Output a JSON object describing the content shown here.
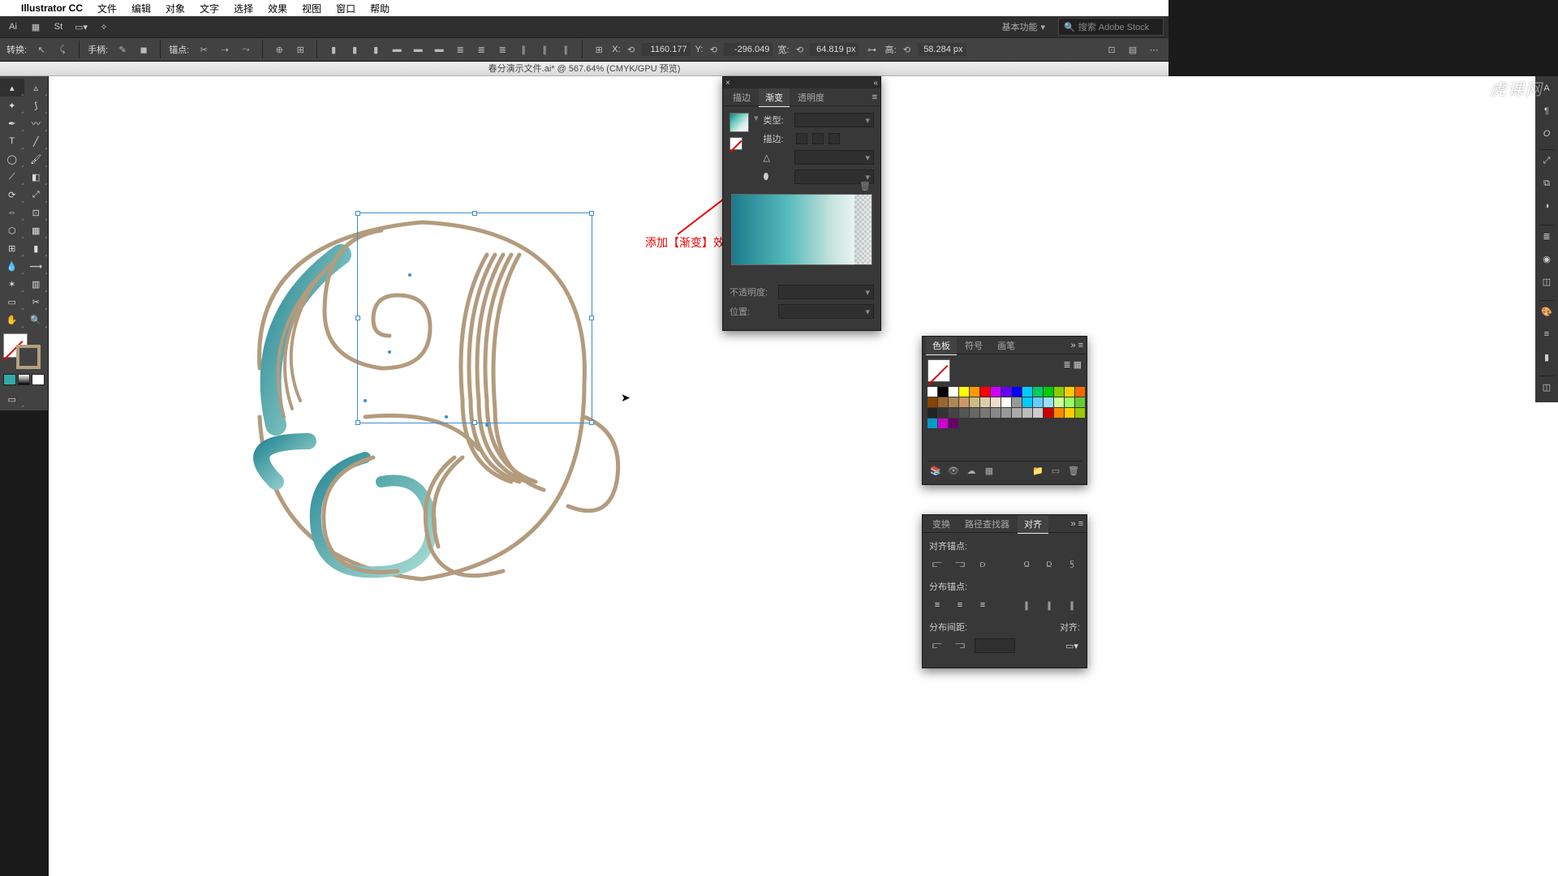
{
  "menubar": {
    "app": "Illustrator CC",
    "items": [
      "文件",
      "编辑",
      "对象",
      "文字",
      "选择",
      "效果",
      "视图",
      "窗口",
      "帮助"
    ]
  },
  "appbar": {
    "basic": "基本功能",
    "search_placeholder": "搜索 Adobe Stock"
  },
  "ctrl": {
    "transform": "转换:",
    "handle": "手柄:",
    "anchor": "锚点:",
    "x": "X:",
    "y": "Y:",
    "w": "宽:",
    "h": "高:",
    "xv": "1160.177",
    "yv": "-296.049",
    "wv": "64.819 px",
    "hv": "58.284 px"
  },
  "document": {
    "title": "春分演示文件.ai* @ 567.64% (CMYK/GPU 预览)"
  },
  "gradient": {
    "tabs": [
      "描边",
      "渐变",
      "透明度"
    ],
    "active_tab": "渐变",
    "type_label": "类型:",
    "stroke_label": "描边:",
    "angle_icon": "△",
    "opacity_label": "不透明度:",
    "position_label": "位置:"
  },
  "swatches": {
    "tabs": [
      "色板",
      "符号",
      "画笔"
    ],
    "active_tab": "色板",
    "colors1": [
      "#fff",
      "#000",
      "#fff",
      "#ff0",
      "#f90",
      "#f00",
      "#c0f",
      "#60f",
      "#00f",
      "#0cf",
      "#0c6",
      "#0c0",
      "#8c0",
      "#fc0",
      "#f60"
    ],
    "colors2": [
      "#840",
      "#963",
      "#a85",
      "#c96",
      "#cb8",
      "#dca",
      "#edc",
      "#fff",
      "#999",
      "#0cf",
      "#6cf",
      "#9df",
      "#cf9",
      "#9f6",
      "#6c3"
    ],
    "colors3": [
      "#222",
      "#333",
      "#444",
      "#555",
      "#666",
      "#777",
      "#888",
      "#999",
      "#aaa",
      "#bbb",
      "#ccc"
    ],
    "colors4": [
      "#c00",
      "#f80",
      "#fc0",
      "#9c0",
      "#09c",
      "#c0c",
      "#606"
    ]
  },
  "align": {
    "tabs": [
      "变换",
      "路径查找器",
      "对齐"
    ],
    "active_tab": "对齐",
    "anchor_label": "对齐锚点:",
    "distribute_label": "分布锚点:",
    "spacing_label": "分布间距:",
    "align_to": "对齐:"
  },
  "annotation": {
    "text": "添加【渐变】效果"
  },
  "watermark": "虎课网"
}
